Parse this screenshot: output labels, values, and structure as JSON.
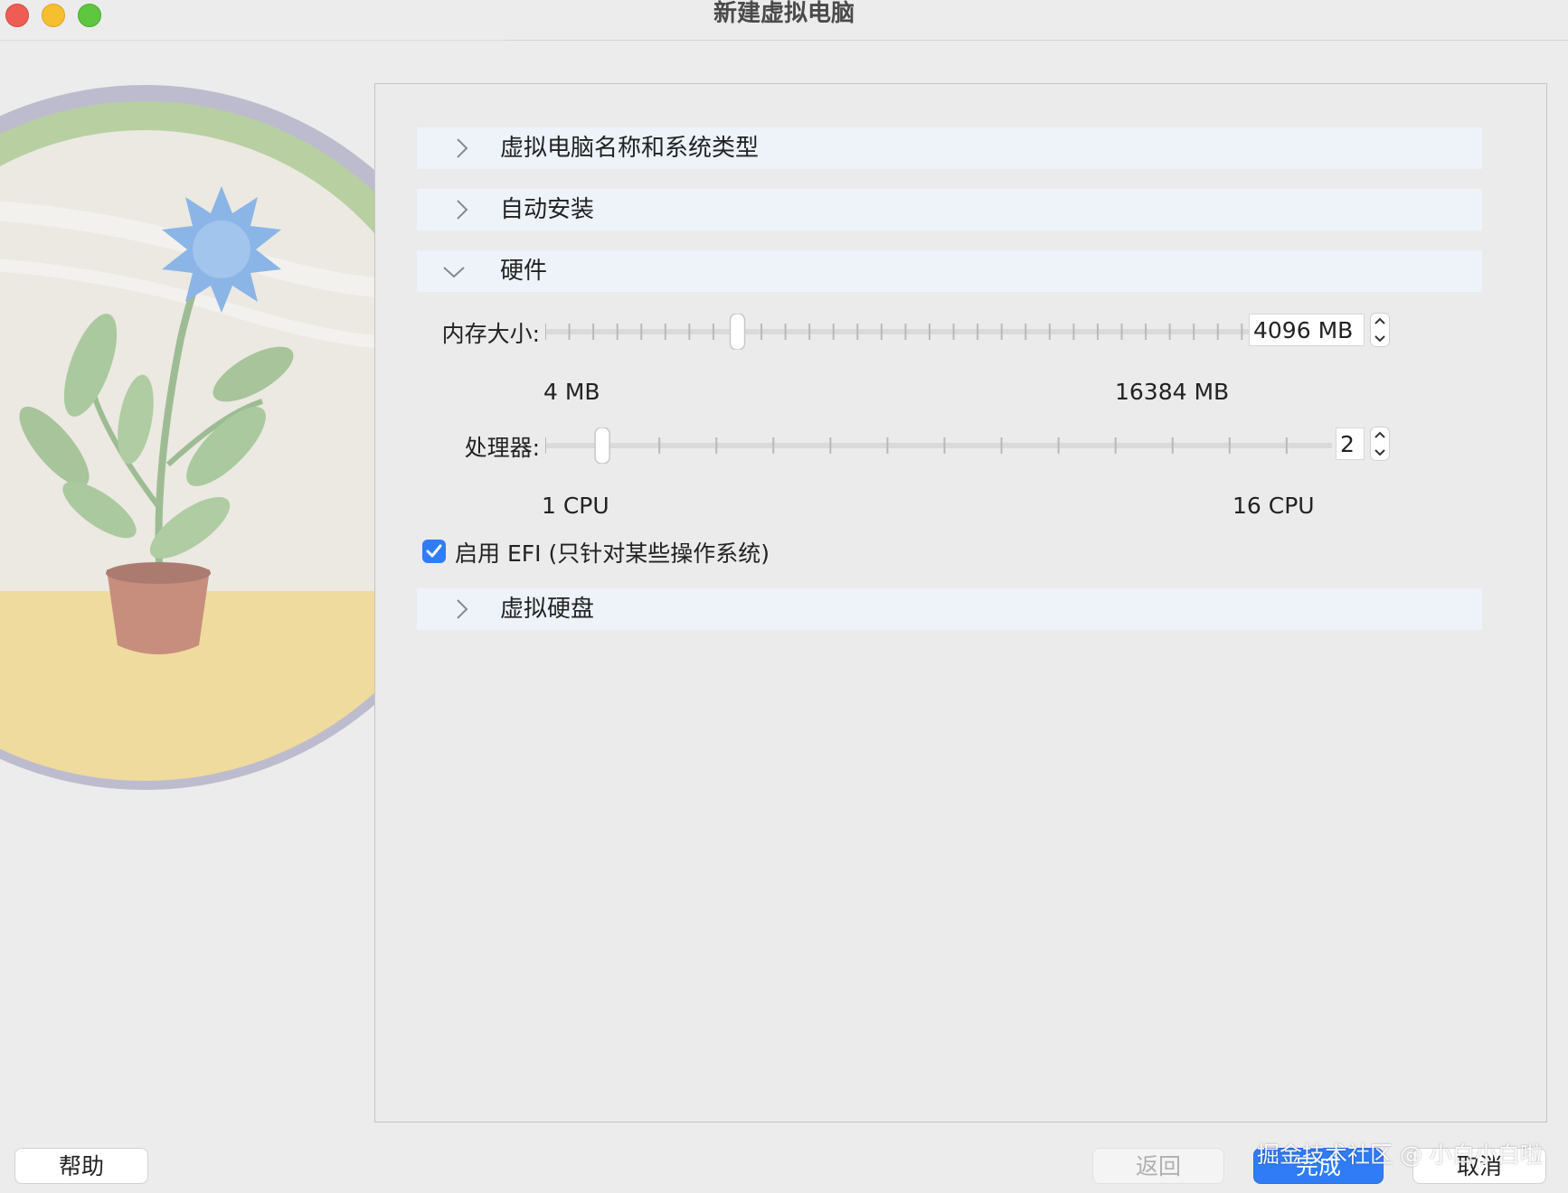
{
  "window": {
    "title": "新建虚拟电脑"
  },
  "sections": [
    {
      "label": "虚拟电脑名称和系统类型",
      "expanded": false
    },
    {
      "label": "自动安装",
      "expanded": false
    },
    {
      "label": "硬件",
      "expanded": true
    },
    {
      "label": "虚拟硬盘",
      "expanded": false
    }
  ],
  "hardware": {
    "memory": {
      "label": "内存大小:",
      "value": "4096 MB",
      "min_label": "4 MB",
      "max_label": "16384 MB",
      "level": 0.25
    },
    "cpu": {
      "label": "处理器:",
      "value": "2",
      "min_label": "1 CPU",
      "max_label": "16 CPU",
      "level": 0.0667
    },
    "efi": {
      "label": "启用 EFI (只针对某些操作系统)",
      "checked": true
    }
  },
  "buttons": {
    "help": "帮助",
    "back": "返回",
    "finish": "完成",
    "cancel": "取消"
  },
  "watermark": "掘金技术社区 @ 小白小白啦",
  "colors": {
    "accent": "#2f7cf6",
    "section_bg": "#eef3fa"
  }
}
